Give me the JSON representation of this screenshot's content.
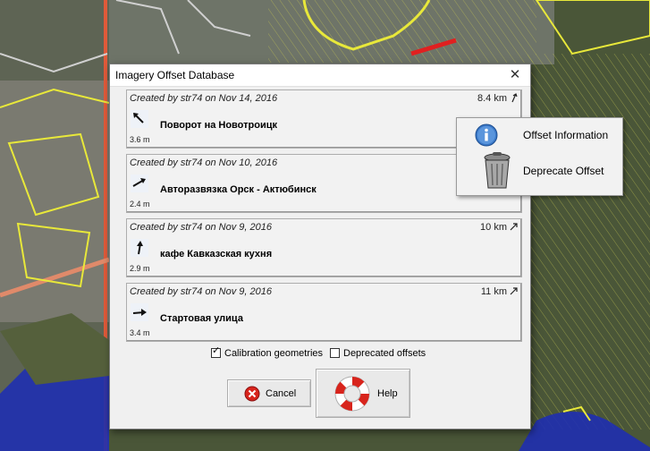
{
  "dialog": {
    "title": "Imagery Offset Database",
    "close_glyph": "✕"
  },
  "entries": [
    {
      "created": "Created by str74 on Nov 14, 2016",
      "distance": "8.4 km",
      "name": "Поворот на Новотроицк",
      "offset": "3.6 m",
      "icon": "offset-arrow-icon"
    },
    {
      "created": "Created by str74 on Nov 10, 2016",
      "distance": "",
      "name": "Авторазвязка Орск - Актюбинск",
      "offset": "2.4 m",
      "icon": "offset-arrow-icon"
    },
    {
      "created": "Created by str74 on Nov 9, 2016",
      "distance": "10 km",
      "name": "кафе Кавказская кухня",
      "offset": "2.9 m",
      "icon": "offset-arrow-icon"
    },
    {
      "created": "Created by str74 on Nov 9, 2016",
      "distance": "11 km",
      "name": "Стартовая улица",
      "offset": "3.4 m",
      "icon": "offset-arrow-icon"
    }
  ],
  "options": {
    "calibration_label": "Calibration geometries",
    "calibration_checked": true,
    "deprecated_label": "Deprecated offsets",
    "deprecated_checked": false
  },
  "buttons": {
    "cancel_label": "Cancel",
    "help_label": "Help"
  },
  "popup_menu": {
    "info_label": "Offset Information",
    "deprecate_label": "Deprecate Offset"
  },
  "colors": {
    "map_dark": "#3d4a33",
    "map_lines_yellow": "#e8e83a",
    "road_red": "#e05a3a",
    "water_blue": "#1f2fb0",
    "cancel_red": "#d8241c",
    "info_blue": "#3a78c8"
  }
}
